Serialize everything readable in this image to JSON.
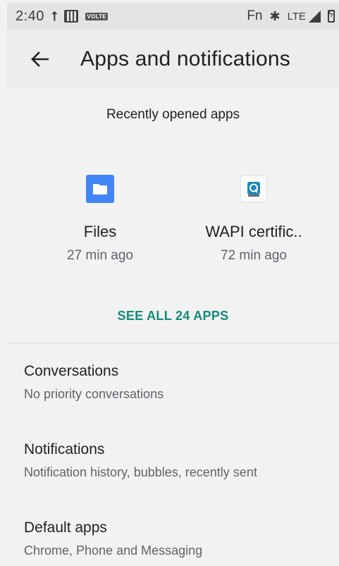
{
  "status_bar": {
    "time": "2:40",
    "volte": "VOLTE",
    "fn": "Fn",
    "network": "LTE",
    "icons": [
      "upload-icon",
      "sim-icon",
      "volte-icon",
      "bluetooth-icon",
      "signal-icon",
      "battery-charging-icon"
    ]
  },
  "app_bar": {
    "title": "Apps and notifications",
    "back_icon": "arrow-back-icon"
  },
  "recent": {
    "header": "Recently opened apps",
    "apps": [
      {
        "name": "Files",
        "time": "27 min ago",
        "icon": "folder-icon",
        "color": "#4285f4"
      },
      {
        "name": "WAPI certific..",
        "time": "72 min ago",
        "icon": "wapi-cert-icon",
        "color": "#1e88b6"
      }
    ],
    "see_all": "SEE ALL 24 APPS"
  },
  "settings": [
    {
      "title": "Conversations",
      "summary": "No priority conversations"
    },
    {
      "title": "Notifications",
      "summary": "Notification history, bubbles, recently sent"
    },
    {
      "title": "Default apps",
      "summary": "Chrome, Phone and Messaging"
    }
  ],
  "colors": {
    "accent": "#138a7a",
    "background": "#f2f2f2",
    "status_bar": "#e4e4e4",
    "app_bar": "#ededed"
  }
}
